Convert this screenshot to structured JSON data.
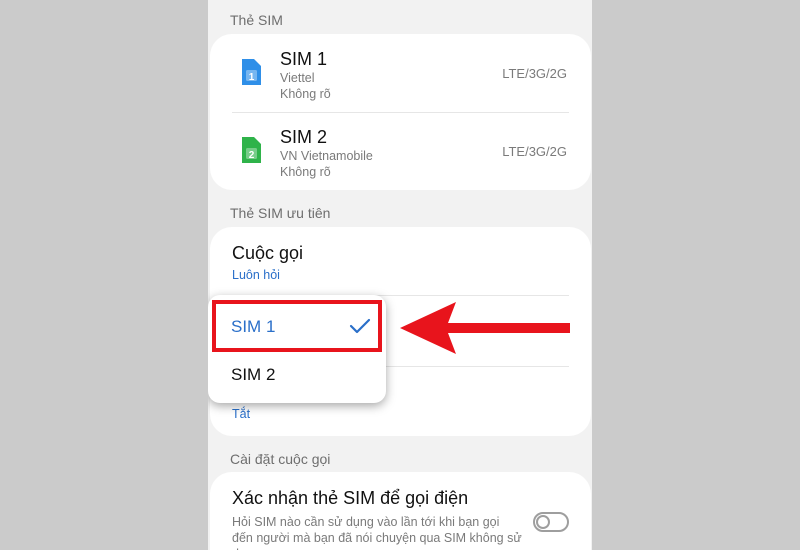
{
  "sim_cards": {
    "header": "Thẻ SIM",
    "items": [
      {
        "name": "SIM 1",
        "carrier": "Viettel",
        "number": "Không rõ",
        "network": "LTE/3G/2G",
        "badge": "1",
        "color": "#2f8fe8"
      },
      {
        "name": "SIM 2",
        "carrier": "VN Vietnamobile",
        "number": "Không rõ",
        "network": "LTE/3G/2G",
        "badge": "2",
        "color": "#2fb34a"
      }
    ]
  },
  "preferred": {
    "header": "Thẻ SIM ưu tiên",
    "calls_title": "Cuộc gọi",
    "calls_value": "Luôn hỏi",
    "hidden_value": "Tắt"
  },
  "popup": {
    "options": [
      "SIM 1",
      "SIM 2"
    ],
    "selected": "SIM 1",
    "selected_color": "#2a6fc9"
  },
  "call_settings": {
    "header": "Cài đặt cuộc gọi",
    "confirm_title": "Xác nhận thẻ SIM để gọi điện",
    "confirm_desc": "Hỏi SIM nào cần sử dụng vào lần tới khi bạn gọi đến người mà bạn đã nói chuyện qua SIM không sử dụng",
    "toggle_on": false
  },
  "annotation": {
    "highlight_color": "#e8141c"
  }
}
